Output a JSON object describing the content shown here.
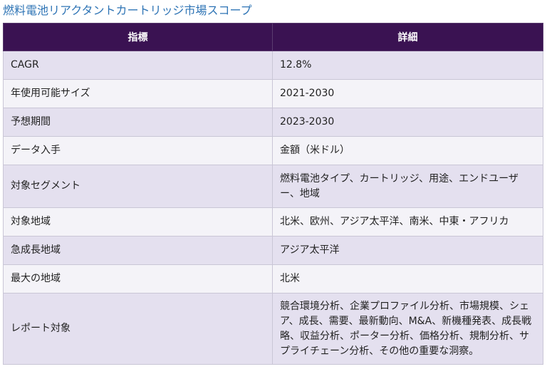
{
  "title": "燃料電池リアクタントカートリッジ市場スコープ",
  "table": {
    "headers": [
      "指標",
      "詳細"
    ],
    "rows": [
      {
        "label": "CAGR",
        "value": "12.8%"
      },
      {
        "label": "年使用可能サイズ",
        "value": "2021-2030"
      },
      {
        "label": "予想期間",
        "value": "2023-2030"
      },
      {
        "label": "データ入手",
        "value": "金額（米ドル）"
      },
      {
        "label": "対象セグメント",
        "value": "燃料電池タイプ、カートリッジ、用途、エンドユーザー、地域"
      },
      {
        "label": "対象地域",
        "value": "北米、欧州、アジア太平洋、南米、中東・アフリカ"
      },
      {
        "label": "急成長地域",
        "value": "アジア太平洋"
      },
      {
        "label": "最大の地域",
        "value": "北米"
      },
      {
        "label": "レポート対象",
        "value": "競合環境分析、企業プロファイル分析、市場規模、シェア、成長、需要、最新動向、M&A、新機種発表、成長戦略、収益分析、ポーター分析、価格分析、規制分析、サプライチェーン分析、その他の重要な洞察。"
      }
    ]
  }
}
